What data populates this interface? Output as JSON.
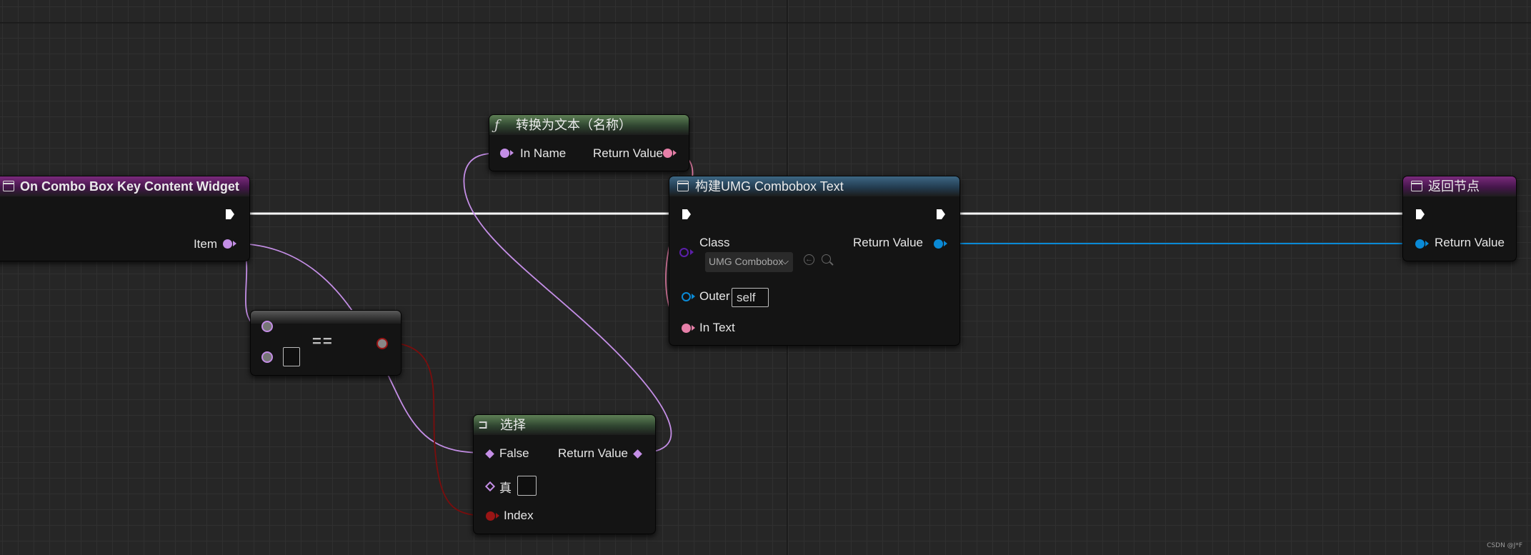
{
  "nodes": {
    "event_node": {
      "title": "On Combo Box Key Content Widget",
      "pin_item": "Item"
    },
    "to_text_node": {
      "title": "转换为文本（名称）",
      "pin_in_name": "In Name",
      "pin_return": "Return Value"
    },
    "construct_node": {
      "title": "构建UMG Combobox Text",
      "pin_class": "Class",
      "class_value": "UMG Combobox",
      "pin_outer": "Outer",
      "outer_value": "self",
      "pin_in_text": "In Text",
      "pin_return": "Return Value"
    },
    "return_node": {
      "title": "返回节点",
      "pin_return": "Return Value"
    },
    "equal_node": {
      "operator": "=="
    },
    "select_node": {
      "title": "选择",
      "pin_false": "False",
      "pin_true": "真",
      "pin_index": "Index",
      "pin_return": "Return Value"
    }
  },
  "watermark": "CSDN @J*F",
  "colors": {
    "background": "#262626",
    "exec_wire": "#ffffff",
    "object_wire": "#0a8ad6",
    "name_wire": "#c48ee6",
    "text_wire": "#e67fa8",
    "bool_wire": "#7a0d0d",
    "class_pin": "#5b1fa8",
    "event_header": "#7a2a7c",
    "pure_header": "#5e8055",
    "function_header": "#3d6784"
  }
}
